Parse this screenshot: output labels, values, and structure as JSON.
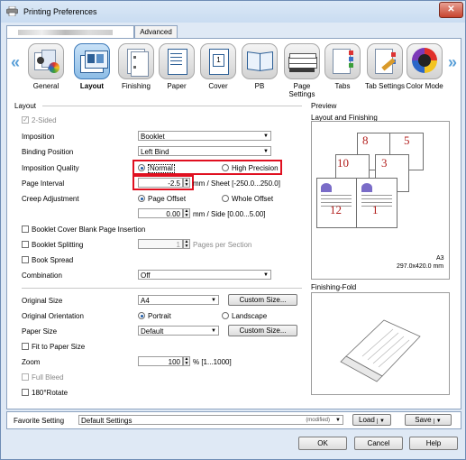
{
  "window": {
    "title": "Printing Preferences",
    "close": "✕"
  },
  "tabs": {
    "first_blurred": "",
    "advanced": "Advanced"
  },
  "functions": [
    {
      "label": "General",
      "icon": "general-icon"
    },
    {
      "label": "Layout",
      "icon": "layout-icon"
    },
    {
      "label": "Finishing",
      "icon": "finishing-icon"
    },
    {
      "label": "Paper",
      "icon": "paper-icon"
    },
    {
      "label": "Cover",
      "icon": "cover-icon"
    },
    {
      "label": "PB",
      "icon": "pb-icon"
    },
    {
      "label": "Page Settings",
      "icon": "page-settings-icon"
    },
    {
      "label": "Tabs",
      "icon": "tabs-icon"
    },
    {
      "label": "Tab Settings",
      "icon": "tab-settings-icon"
    },
    {
      "label": "Color Mode",
      "icon": "color-mode-icon"
    }
  ],
  "nav": {
    "left": "«",
    "right": "»"
  },
  "layout": {
    "section": "Layout",
    "two_sided": "2-Sided",
    "imposition": {
      "label": "Imposition",
      "value": "Booklet"
    },
    "binding_position": {
      "label": "Binding Position",
      "value": "Left Bind"
    },
    "imposition_quality": {
      "label": "Imposition Quality",
      "opt1": "Normal",
      "opt2": "High Precision"
    },
    "page_interval": {
      "label": "Page Interval",
      "value": "-2.5",
      "suffix": "mm / Sheet [-250.0...250.0]"
    },
    "creep": {
      "label": "Creep Adjustment",
      "opt1": "Page Offset",
      "opt2": "Whole Offset",
      "value": "0.00",
      "suffix": "mm / Side [0.00...5.00]"
    },
    "booklet_cover_blank": "Booklet Cover Blank Page Insertion",
    "booklet_splitting": {
      "label": "Booklet Splitting",
      "value": "1",
      "suffix": "Pages per Section"
    },
    "book_spread": "Book Spread",
    "combination": {
      "label": "Combination",
      "value": "Off"
    },
    "original_size": {
      "label": "Original Size",
      "value": "A4",
      "button": "Custom Size..."
    },
    "original_orientation": {
      "label": "Original Orientation",
      "opt1": "Portrait",
      "opt2": "Landscape"
    },
    "paper_size": {
      "label": "Paper Size",
      "value": "Default",
      "button": "Custom Size..."
    },
    "fit_to_paper": "Fit to Paper Size",
    "zoom": {
      "label": "Zoom",
      "value": "100",
      "suffix": "% [1...1000]"
    },
    "full_bleed": "Full Bleed",
    "rotate": "180°Rotate"
  },
  "preview": {
    "section": "Preview",
    "subtitle": "Layout and Finishing",
    "pages": [
      "8",
      "5",
      "10",
      "3",
      "12",
      "1"
    ],
    "paper": "A3",
    "paper_dims": "297.0x420.0 mm",
    "fold_label": "Finishing-Fold"
  },
  "bottom": {
    "favorite_label": "Favorite Setting",
    "favorite_value": "Default Settings",
    "modified": "(modified)",
    "load": "Load",
    "save": "Save"
  },
  "dialog": {
    "ok": "OK",
    "cancel": "Cancel",
    "help": "Help"
  }
}
